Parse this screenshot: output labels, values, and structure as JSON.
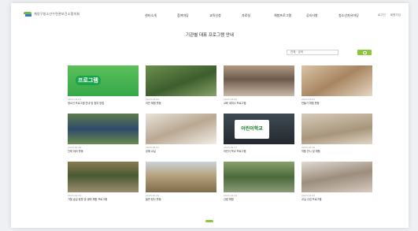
{
  "header": {
    "logo_text": "계양구청소년수련관보건소협의회",
    "nav": [
      "센터소개",
      "참여마당",
      "교육신청",
      "자료실",
      "체험프로그램",
      "공지사항",
      "청소년자유마당"
    ],
    "util": [
      "로그인",
      "회원가입"
    ]
  },
  "page_title": "기관별 대표 프로그램 안내",
  "search": {
    "value": "전체 · 검색",
    "button": ""
  },
  "colors": {
    "accent": "#8cc63f",
    "brand_green": "#7ab648",
    "brand_blue": "#2f7fc1"
  },
  "cards": [
    {
      "thumb_text": "프로그램",
      "date": "2023.03.03",
      "caption": "청소년 프로그램 안내 및 참여 방법",
      "theme": "green-banner"
    },
    {
      "thumb_text": "",
      "date": "2023.03.02",
      "caption": "자연 체험 활동",
      "theme": "forest"
    },
    {
      "thumb_text": "",
      "date": "2023.03.02",
      "caption": "교육 세미나 프로그램",
      "theme": "hall"
    },
    {
      "thumb_text": "",
      "date": "2023.03.01",
      "caption": "만들기 체험 활동",
      "theme": "craft"
    },
    {
      "thumb_text": "",
      "date": "2023.02.28",
      "caption": "단체 야외 활동",
      "theme": "group"
    },
    {
      "thumb_text": "",
      "date": "2023.02.27",
      "caption": "공예 교실",
      "theme": "class"
    },
    {
      "thumb_text": "어린이학교",
      "date": "2023.02.27",
      "caption": "어린이 학교 프로그램",
      "theme": "sign"
    },
    {
      "thumb_text": "",
      "date": "2023.02.26",
      "caption": "작품 전시 및 체험",
      "theme": "exhibit"
    },
    {
      "thumb_text": "",
      "date": "2023.02.25",
      "caption": "가을 숲길 탐방 및 생태 체험 프로그램",
      "theme": "autumn"
    },
    {
      "thumb_text": "",
      "date": "2023.02.24",
      "caption": "들판 탐사 활동",
      "theme": "field"
    },
    {
      "thumb_text": "",
      "date": "2023.02.24",
      "caption": "산림 체험",
      "theme": "woods"
    },
    {
      "thumb_text": "",
      "date": "2023.02.23",
      "caption": "교실 수업 프로그램",
      "theme": "classroom"
    }
  ]
}
